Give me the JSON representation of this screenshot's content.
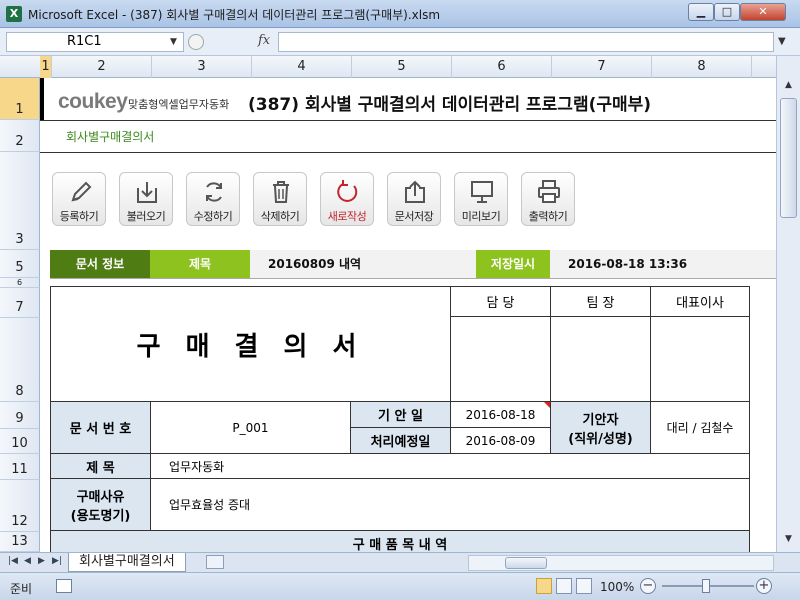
{
  "window": {
    "app_icon": "X",
    "title": "Microsoft Excel - (387) 회사별 구매결의서 데이터관리 프로그램(구매부).xlsm",
    "minimize": "▁",
    "maximize": "□",
    "close": "✕"
  },
  "formula_bar": {
    "name_box": "R1C1",
    "fx": "fx",
    "formula": ""
  },
  "columns": [
    "1",
    "2",
    "3",
    "4",
    "5",
    "6",
    "7",
    "8"
  ],
  "rows": [
    "1",
    "2",
    "3",
    "5",
    "6",
    "7",
    "8",
    "9",
    "10",
    "11",
    "12",
    "13"
  ],
  "header": {
    "logo": "coukey",
    "logo_sub": "맞춤형엑셀업무자동화",
    "title": "(387) 회사별 구매결의서 데이터관리 프로그램(구매부)",
    "subtitle": "회사별구매결의서"
  },
  "toolbar": [
    {
      "label": "등록하기",
      "icon": "pencil-icon"
    },
    {
      "label": "불러오기",
      "icon": "download-icon"
    },
    {
      "label": "수정하기",
      "icon": "refresh-icon"
    },
    {
      "label": "삭제하기",
      "icon": "trash-icon"
    },
    {
      "label": "새로작성",
      "icon": "new-icon"
    },
    {
      "label": "문서저장",
      "icon": "upload-icon"
    },
    {
      "label": "미리보기",
      "icon": "monitor-icon"
    },
    {
      "label": "출력하기",
      "icon": "printer-icon"
    }
  ],
  "info_bar": {
    "doc_info_label": "문서 정보",
    "title_label": "제목",
    "title_value": "20160809 내역",
    "saved_label": "저장일시",
    "saved_value": "2016-08-18 13:36"
  },
  "form": {
    "doc_title": "구 매 결 의 서",
    "approvals": [
      "담 당",
      "팀 장",
      "대표이사"
    ],
    "doc_no_label": "문 서 번 호",
    "doc_no_value": "P_001",
    "draft_date_label": "기 안 일",
    "draft_date_value": "2016-08-18",
    "process_date_label": "처리예정일",
    "process_date_value": "2016-08-09",
    "drafter_label_1": "기안자",
    "drafter_label_2": "(직위/성명)",
    "drafter_value": "대리 / 김철수",
    "subject_label": "제      목",
    "subject_value": "업무자동화",
    "reason_label_1": "구매사유",
    "reason_label_2": "(용도명기)",
    "reason_value": "업무효율성 증대",
    "items_header": "구 매 품 목 내 역"
  },
  "sheet_tabs": {
    "active": "회사별구매결의서"
  },
  "status_bar": {
    "mode": "준비",
    "zoom": "100%"
  },
  "colors": {
    "dark_green": "#4f7c13",
    "light_green": "#8dc21f",
    "header_blue": "#dce6f1",
    "accent_red": "#c2262c"
  }
}
